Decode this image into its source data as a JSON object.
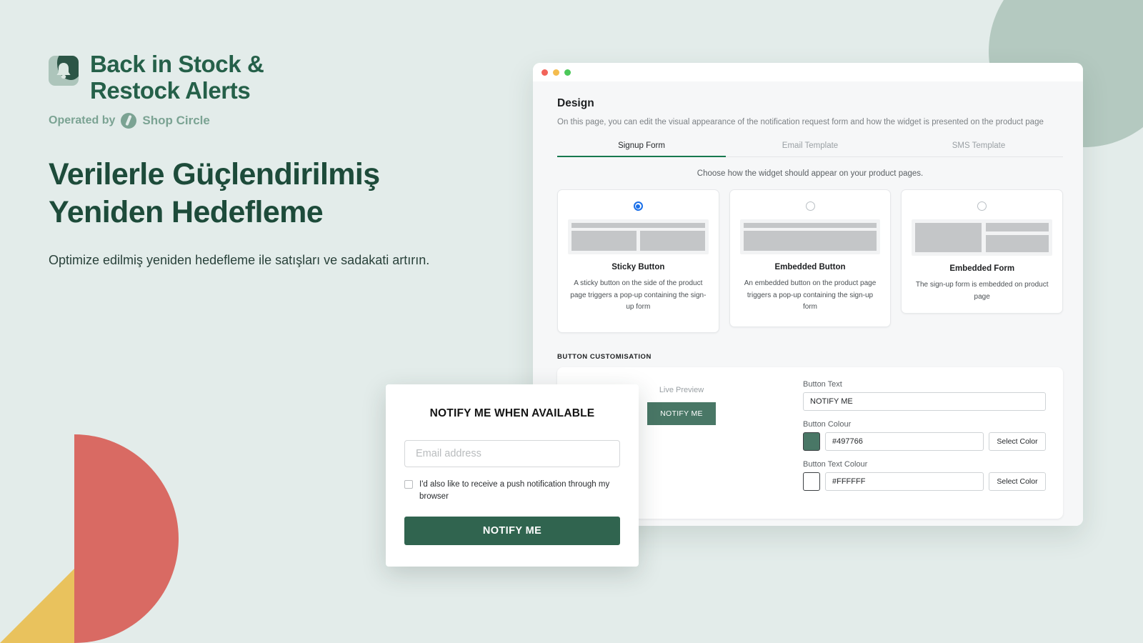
{
  "brand": {
    "title_line1": "Back in Stock &",
    "title_line2": "Restock Alerts",
    "operated_by": "Operated by",
    "company": "Shop Circle",
    "badge_icon": "bell-icon",
    "mark_icon": "shop-circle-logo-icon"
  },
  "hero": {
    "headline_line1": "Verilerle Güçlendirilmiş",
    "headline_line2": "Yeniden Hedefleme",
    "subhead": "Optimize edilmiş yeniden hedefleme ile satışları ve sadakati artırın."
  },
  "app": {
    "titlebar": {
      "close": "close",
      "minimize": "minimize",
      "maximize": "maximize"
    },
    "page_title": "Design",
    "page_desc": "On this page, you can edit the visual appearance of the notification request form and how the widget is presented on the product page",
    "tabs": [
      {
        "label": "Signup Form",
        "active": true
      },
      {
        "label": "Email Template",
        "active": false
      },
      {
        "label": "SMS Template",
        "active": false
      }
    ],
    "choose_line": "Choose how the widget should appear on your product pages.",
    "options": [
      {
        "name": "Sticky Button",
        "desc": "A sticky button on the side of the product page triggers a pop-up containing the sign-up form",
        "selected": true
      },
      {
        "name": "Embedded Button",
        "desc": "An embedded button on the product page triggers a pop-up containing the sign-up form",
        "selected": false
      },
      {
        "name": "Embedded Form",
        "desc": "The sign-up form is embedded on product page",
        "selected": false
      }
    ],
    "section_label": "BUTTON CUSTOMISATION",
    "preview": {
      "label": "Live Preview",
      "button_text": "NOTIFY ME"
    },
    "fields": {
      "button_text_label": "Button Text",
      "button_text_value": "NOTIFY ME",
      "button_colour_label": "Button Colour",
      "button_colour_value": "#497766",
      "button_text_colour_label": "Button Text Colour",
      "button_text_colour_value": "#FFFFFF",
      "select_color_label": "Select Color"
    }
  },
  "widget": {
    "title": "NOTIFY ME WHEN AVAILABLE",
    "email_placeholder": "Email address",
    "checkbox_text": "I'd also like to receive a push notification through my browser",
    "cta_label": "NOTIFY ME"
  },
  "colors": {
    "page_bg": "#e3ecea",
    "brand_green": "#256049",
    "headline_green": "#1d4b3a",
    "sage": "#b4c9c0",
    "accent_red": "#d96a63",
    "accent_yellow": "#e9c25d",
    "tab_underline": "#17794f",
    "button_colour": "#497766",
    "button_text_colour": "#FFFFFF",
    "radio_blue": "#1a6fe8"
  }
}
